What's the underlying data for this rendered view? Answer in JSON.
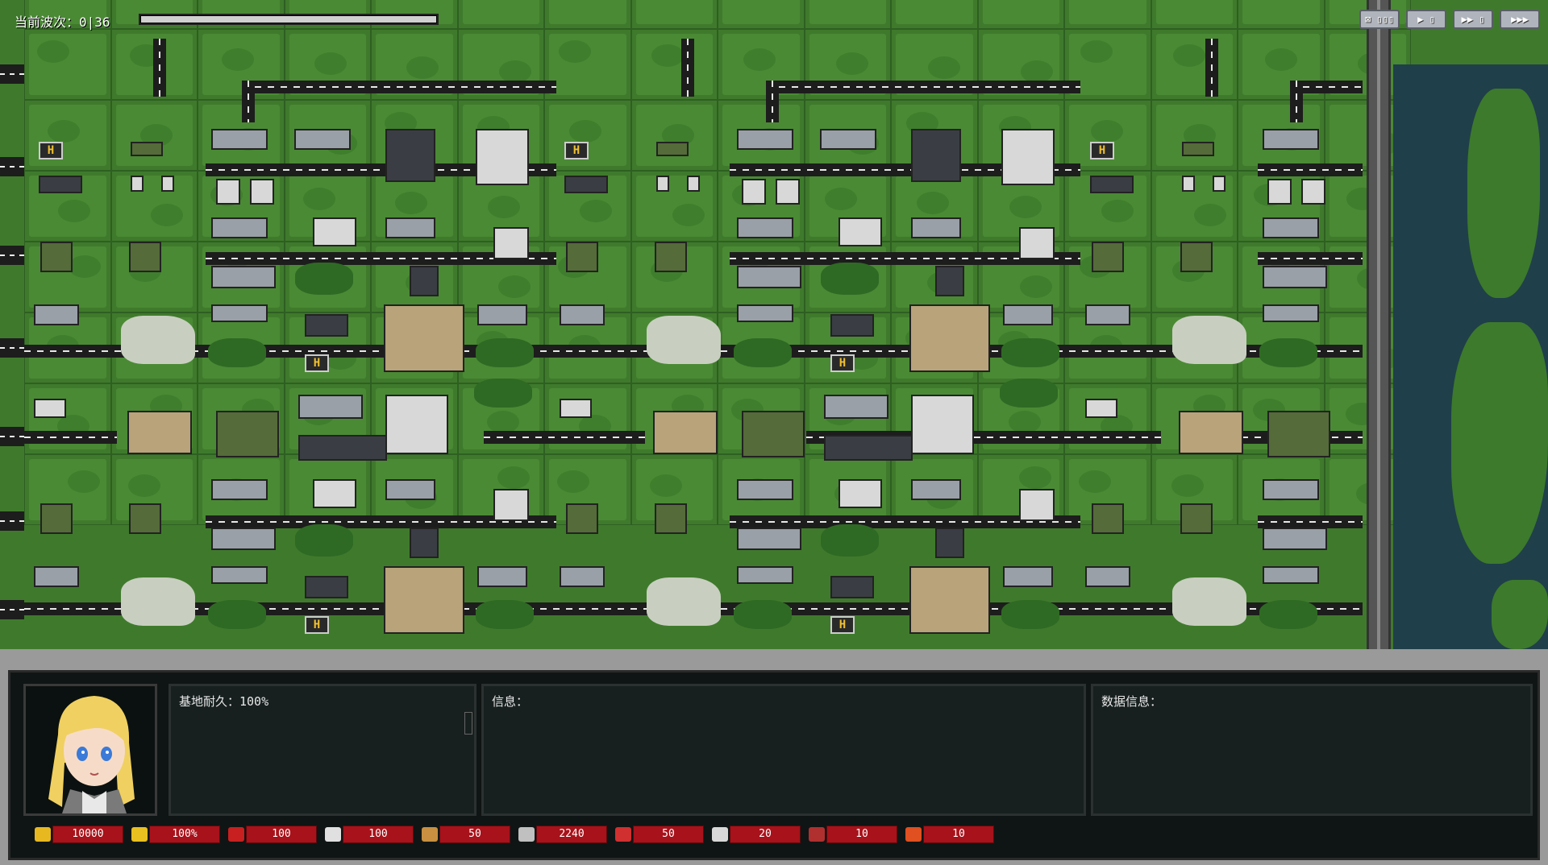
{
  "hud": {
    "wave_label": "当前波次：0|36",
    "wave_progress_percent": 100
  },
  "speed_controls": [
    {
      "name": "skip-button",
      "label": "⊠ ▯▯▯"
    },
    {
      "name": "play-1x-button",
      "label": "▶ ▯"
    },
    {
      "name": "play-2x-button",
      "label": "▶▶ ▯"
    },
    {
      "name": "play-3x-button",
      "label": "▶▶▶"
    }
  ],
  "panel": {
    "base_durability": "基地耐久：100%",
    "info_label": "信息：",
    "data_label": "数据信息："
  },
  "resources": [
    {
      "icon": "gold-coin-icon",
      "color": "#e8b820",
      "value": "10000"
    },
    {
      "icon": "morale-icon",
      "color": "#e8c020",
      "value": "100%"
    },
    {
      "icon": "fuel-can-icon",
      "color": "#c82020",
      "value": "100"
    },
    {
      "icon": "medical-icon",
      "color": "#e0e0e0",
      "value": "100"
    },
    {
      "icon": "supply-crate-icon",
      "color": "#c89040",
      "value": "50"
    },
    {
      "icon": "tools-icon",
      "color": "#c0c0c0",
      "value": "2240"
    },
    {
      "icon": "munitions-icon",
      "color": "#d03030",
      "value": "50"
    },
    {
      "icon": "card-icon",
      "color": "#d8d8d8",
      "value": "20"
    },
    {
      "icon": "radio-icon",
      "color": "#b03030",
      "value": "10"
    },
    {
      "icon": "missile-icon",
      "color": "#e05020",
      "value": "10"
    }
  ]
}
